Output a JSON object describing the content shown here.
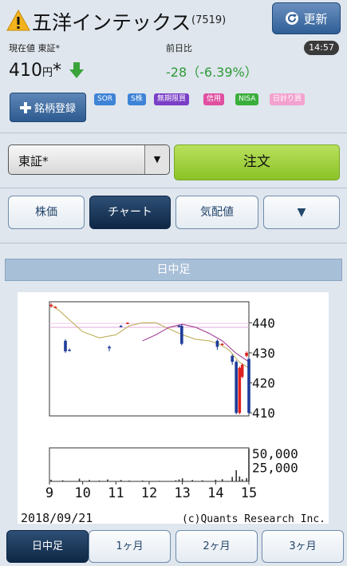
{
  "header": {
    "title": "五洋インテックス",
    "code": "(7519)",
    "refresh_label": "更新",
    "time": "14:57"
  },
  "quote": {
    "price_label": "現在値 東証*",
    "price": "410",
    "unit": "円",
    "mark": "*",
    "change_label": "前日比",
    "change": "-28（-6.39%）",
    "register_label": "銘柄登録",
    "badges": [
      {
        "label": "SOR",
        "color": "#3f83d6"
      },
      {
        "label": "S株",
        "color": "#3f83d6"
      },
      {
        "label": "無期限買",
        "color": "#7a3fc6"
      },
      {
        "label": "信用",
        "color": "#e04fa0"
      },
      {
        "label": "NISA",
        "color": "#3aae3a"
      },
      {
        "label": "日計り買",
        "color": "#f3a2cf"
      }
    ]
  },
  "market": {
    "selected": "東証*",
    "order_label": "注文"
  },
  "tabs": [
    "株価",
    "チャート",
    "気配値",
    "▼"
  ],
  "chart_header": "日中足",
  "chart_data": {
    "type": "line",
    "price_ticks": [
      "440",
      "430",
      "420",
      "410"
    ],
    "volume_ticks": [
      "50,000",
      "25,000"
    ],
    "x_ticks": [
      "9",
      "10",
      "11",
      "12",
      "13",
      "14",
      "15"
    ],
    "date": "2018/09/21",
    "credit": "(c)Quants Research Inc.",
    "ylim": [
      409,
      447
    ],
    "candles": [
      {
        "t": 9.05,
        "o": 446,
        "c": 445.5,
        "h": 446.5,
        "l": 445,
        "color": "#e02020"
      },
      {
        "t": 9.18,
        "o": 445.3,
        "c": 445.1,
        "h": 445.5,
        "l": 445,
        "color": "#e02020"
      },
      {
        "t": 9.48,
        "o": 434,
        "c": 430.5,
        "h": 434.5,
        "l": 430,
        "color": "#1f3c9a"
      },
      {
        "t": 9.6,
        "o": 431,
        "c": 430.8,
        "h": 431.5,
        "l": 430.5,
        "color": "#1f3c9a"
      },
      {
        "t": 10.8,
        "o": 432,
        "c": 431.5,
        "h": 432.5,
        "l": 430.5,
        "color": "#1f3c9a"
      },
      {
        "t": 11.15,
        "o": 439,
        "c": 438.8,
        "h": 439.2,
        "l": 438.5,
        "color": "#1f3c9a"
      },
      {
        "t": 11.35,
        "o": 440,
        "c": 439.8,
        "h": 440.2,
        "l": 439.5,
        "color": "#e02020"
      },
      {
        "t": 12.9,
        "o": 439,
        "c": 438.7,
        "h": 439.3,
        "l": 438.5,
        "color": "#1f3c9a"
      },
      {
        "t": 12.98,
        "o": 439,
        "c": 433,
        "h": 439.5,
        "l": 432.5,
        "color": "#1f3c9a"
      },
      {
        "t": 14.05,
        "o": 434,
        "c": 432,
        "h": 434.5,
        "l": 431,
        "color": "#1f3c9a"
      },
      {
        "t": 14.2,
        "o": 433,
        "c": 432.8,
        "h": 433.2,
        "l": 432.5,
        "color": "#e02020"
      },
      {
        "t": 14.5,
        "o": 429,
        "c": 427,
        "h": 429.5,
        "l": 426,
        "color": "#1f3c9a"
      },
      {
        "t": 14.62,
        "o": 427,
        "c": 410,
        "h": 427.5,
        "l": 409.5,
        "color": "#1f3c9a"
      },
      {
        "t": 14.72,
        "o": 410,
        "c": 425,
        "h": 425.5,
        "l": 409.5,
        "color": "#e02020"
      },
      {
        "t": 14.8,
        "o": 422,
        "c": 426,
        "h": 426.5,
        "l": 421.5,
        "color": "#e02020"
      },
      {
        "t": 14.93,
        "o": 430,
        "c": 429,
        "h": 430.5,
        "l": 428.5,
        "color": "#e02020"
      },
      {
        "t": 15.0,
        "o": 428,
        "c": 410,
        "h": 428.5,
        "l": 409.5,
        "color": "#1f3c9a"
      }
    ],
    "ma_short": {
      "color": "#b8a84a",
      "points": [
        [
          9.05,
          446
        ],
        [
          9.3,
          444
        ],
        [
          9.6,
          441
        ],
        [
          10.0,
          437
        ],
        [
          10.5,
          435
        ],
        [
          11.0,
          436
        ],
        [
          11.4,
          439
        ],
        [
          11.8,
          440
        ],
        [
          12.2,
          440
        ],
        [
          12.6,
          438
        ],
        [
          13.0,
          436
        ],
        [
          13.4,
          434.5
        ],
        [
          13.8,
          434
        ],
        [
          14.1,
          433
        ],
        [
          14.4,
          431
        ],
        [
          14.7,
          427
        ],
        [
          15.0,
          425
        ]
      ]
    },
    "ma_long": {
      "color": "#9c2e8e",
      "points": [
        [
          11.8,
          434
        ],
        [
          12.2,
          436
        ],
        [
          12.6,
          438.5
        ],
        [
          13.0,
          439.5
        ],
        [
          13.4,
          438.5
        ],
        [
          13.8,
          436.5
        ],
        [
          14.2,
          434
        ],
        [
          14.6,
          430
        ],
        [
          15.0,
          427
        ]
      ]
    },
    "ref_lines": [
      {
        "y": 438.5,
        "color": "#e0a8d8"
      },
      {
        "y": 439.8,
        "color": "#f0c8e8"
      }
    ],
    "volume_max": 60000,
    "volume": [
      [
        9.05,
        3000
      ],
      [
        9.4,
        2000
      ],
      [
        9.9,
        5000
      ],
      [
        10.2,
        2500
      ],
      [
        10.5,
        1500
      ],
      [
        10.75,
        3500
      ],
      [
        11.15,
        2500
      ],
      [
        11.4,
        1500
      ],
      [
        11.8,
        1500
      ],
      [
        12.3,
        1000
      ],
      [
        12.8,
        2000
      ],
      [
        12.9,
        3500
      ],
      [
        13.0,
        5500
      ],
      [
        13.3,
        2500
      ],
      [
        13.6,
        2000
      ],
      [
        14.0,
        3000
      ],
      [
        14.2,
        4000
      ],
      [
        14.5,
        8000
      ],
      [
        14.62,
        20000
      ],
      [
        14.72,
        9000
      ],
      [
        14.8,
        4000
      ],
      [
        14.93,
        6000
      ],
      [
        15.0,
        58000
      ]
    ]
  },
  "bottom_tabs": [
    "日中足",
    "1ヶ月",
    "2ヶ月",
    "3ヶ月"
  ]
}
